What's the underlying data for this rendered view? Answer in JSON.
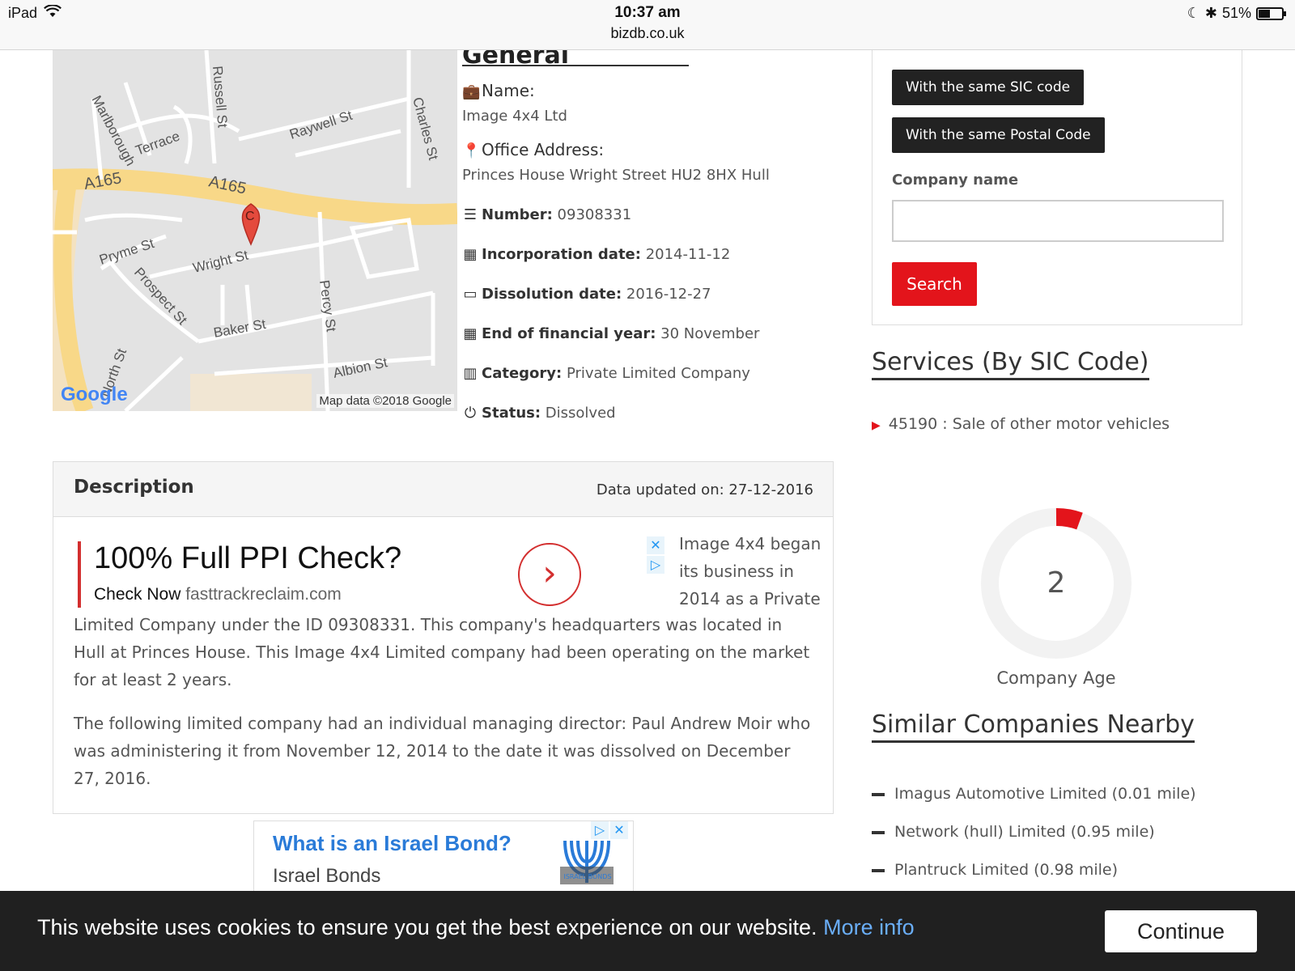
{
  "status_bar": {
    "device": "iPad",
    "time": "10:37 am",
    "url": "bizdb.co.uk",
    "battery": "51%",
    "battery_level": 0.51
  },
  "map": {
    "streets": [
      "Raywell St",
      "Russell St",
      "Marlborough Terrace",
      "Charles St",
      "A165",
      "A165",
      "Pryme St",
      "Wright St",
      "Prospect St",
      "Percy St",
      "Baker St",
      "North St",
      "Albion St"
    ],
    "marker": "C",
    "logo": "Google",
    "attribution": "Map data ©2018 Google"
  },
  "general_info": {
    "heading": "General Information",
    "name_label": "Name:",
    "name_value": "Image 4x4 Ltd",
    "address_label": "Office Address:",
    "address_value": "Princes House Wright Street HU2 8HX Hull",
    "number_label": "Number:",
    "number_value": "09308331",
    "incorporation_label": "Incorporation date:",
    "incorporation_value": "2014-11-12",
    "dissolution_label": "Dissolution date:",
    "dissolution_value": "2016-12-27",
    "fin_year_label": "End of financial year:",
    "fin_year_value": "30 November",
    "category_label": "Category:",
    "category_value": "Private Limited Company",
    "status_label": "Status:",
    "status_value": "Dissolved"
  },
  "description": {
    "title": "Description",
    "updated": "Data updated on: 27-12-2016",
    "para_top": "Image 4x4 began its business in 2014 as a Private",
    "para1": "Limited Company under the ID 09308331. This company's headquarters was located in Hull at Princes House. This Image 4x4 Limited company had been operating on the market for at least 2 years.",
    "para2": "The following limited company had an individual managing director: Paul Andrew Moir who was administering it from November 12, 2014 to the date it was dissolved on December 27, 2016."
  },
  "ad1": {
    "title": "100% Full PPI Check?",
    "cta": "Check Now",
    "domain": "fasttrackreclaim.com"
  },
  "ad2": {
    "title": "What is an Israel Bond?",
    "sub": "Israel Bonds",
    "logo_text": "ISRAEL BONDS"
  },
  "sidebar": {
    "btn_same_sic": "With the same SIC code",
    "btn_same_postal": "With the same Postal Code",
    "company_name_label": "Company name",
    "company_name_value": "",
    "search_button": "Search",
    "services_heading": "Services (By SIC Code)",
    "sic_items": [
      "45190 : Sale of other motor vehicles"
    ],
    "company_age_value": "2",
    "company_age_label": "Company Age",
    "similar_heading": "Similar Companies Nearby",
    "similar_items": [
      "Imagus Automotive Limited (0.01 mile)",
      "Network (hull) Limited (0.95 mile)",
      "Plantruck Limited (0.98 mile)"
    ]
  },
  "cookie": {
    "text": "This website uses cookies to ensure you get the best experience on our website.",
    "link": "More info",
    "button": "Continue"
  },
  "colors": {
    "accent_red": "#e3141b",
    "dark_button": "#222222",
    "link_blue": "#6aaef7"
  }
}
